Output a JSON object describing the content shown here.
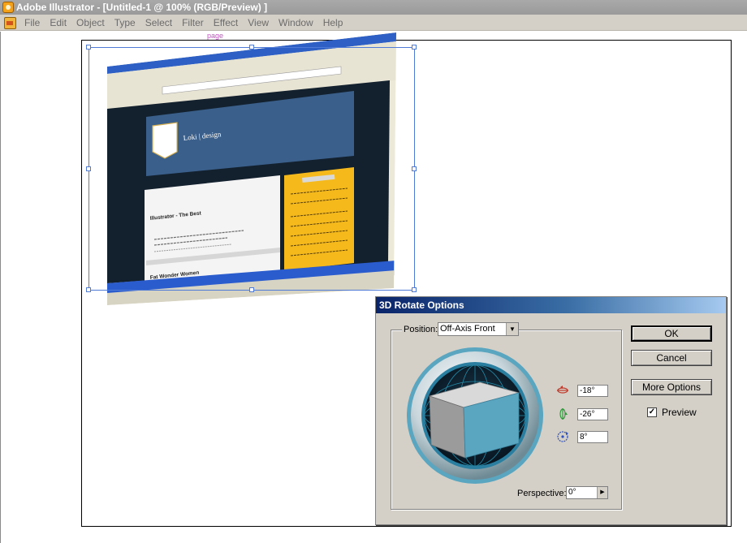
{
  "window": {
    "title": "Adobe Illustrator - [Untitled-1 @ 100% (RGB/Preview) ]"
  },
  "menu": {
    "items": [
      "File",
      "Edit",
      "Object",
      "Type",
      "Select",
      "Filter",
      "Effect",
      "View",
      "Window",
      "Help"
    ]
  },
  "artboard": {
    "page_label": "page"
  },
  "artwork": {
    "site_logo_text": "Loki | design",
    "post1_title": "Illustrator - The Best",
    "post2_title": "Fat Wonder Women"
  },
  "dialog": {
    "title": "3D Rotate Options",
    "position_label": "Position:",
    "position_value": "Off-Axis Front",
    "x_rotation": "-18°",
    "y_rotation": "-26°",
    "z_rotation": "8°",
    "perspective_label": "Perspective:",
    "perspective_value": "0°",
    "ok_label": "OK",
    "cancel_label": "Cancel",
    "more_options_label": "More Options",
    "preview_label": "Preview",
    "preview_checked": true
  },
  "colors": {
    "cube_front": "#5aa5bf",
    "cube_top": "#d9d9d9",
    "cube_side": "#9b9b9b",
    "site_header": "#3a5f8a",
    "site_sidebar": "#f6b91b"
  }
}
